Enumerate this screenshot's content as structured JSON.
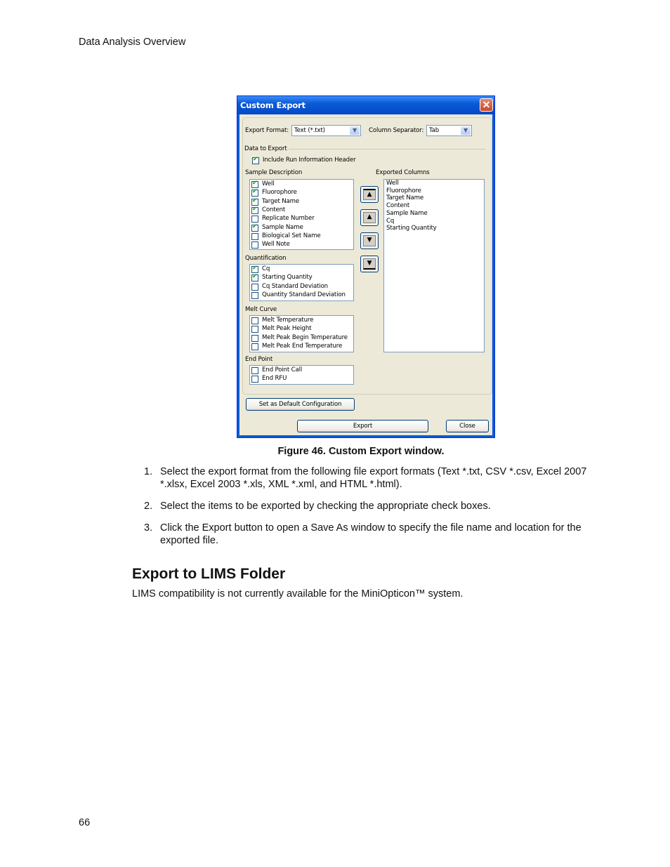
{
  "running_head": "Data Analysis Overview",
  "page_number": "66",
  "dialog": {
    "title": "Custom Export",
    "close_glyph": "✕",
    "export_format_label": "Export Format:",
    "export_format_value": "Text (*.txt)",
    "column_separator_label": "Column Separator:",
    "column_separator_value": "Tab",
    "data_to_export_label": "Data to Export",
    "include_header": {
      "label": "Include Run Information Header",
      "checked": true
    },
    "sample_description": {
      "label": "Sample Description",
      "items": [
        {
          "label": "Well",
          "checked": true
        },
        {
          "label": "Fluorophore",
          "checked": true
        },
        {
          "label": "Target Name",
          "checked": true
        },
        {
          "label": "Content",
          "checked": true
        },
        {
          "label": "Replicate Number",
          "checked": false
        },
        {
          "label": "Sample Name",
          "checked": true
        },
        {
          "label": "Biological Set Name",
          "checked": false
        },
        {
          "label": "Well Note",
          "checked": false
        }
      ]
    },
    "quantification": {
      "label": "Quantification",
      "items": [
        {
          "label": "Cq",
          "checked": true
        },
        {
          "label": "Starting Quantity",
          "checked": true
        },
        {
          "label": "Cq Standard Deviation",
          "checked": false
        },
        {
          "label": "Quantity Standard Deviation",
          "checked": false
        }
      ]
    },
    "melt_curve": {
      "label": "Melt Curve",
      "items": [
        {
          "label": "Melt Temperature",
          "checked": false
        },
        {
          "label": "Melt Peak Height",
          "checked": false
        },
        {
          "label": "Melt Peak Begin Temperature",
          "checked": false
        },
        {
          "label": "Melt Peak End Temperature",
          "checked": false
        }
      ]
    },
    "end_point": {
      "label": "End Point",
      "items": [
        {
          "label": "End Point Call",
          "checked": false
        },
        {
          "label": "End RFU",
          "checked": false
        }
      ]
    },
    "exported_columns_label": "Exported Columns",
    "exported_columns": [
      "Well",
      "Fluorophore",
      "Target Name",
      "Content",
      "Sample Name",
      "Cq",
      "Starting Quantity"
    ],
    "move_buttons": {
      "top": "▲",
      "up": "▲",
      "down": "▼",
      "bottom": "▼"
    },
    "set_default_label": "Set as Default Configuration",
    "export_label": "Export",
    "close_label": "Close"
  },
  "caption": "Figure 46. Custom Export window.",
  "steps": [
    {
      "n": "1.",
      "text": "Select the export format from the following file export formats (Text *.txt, CSV *.csv, Excel 2007 *.xlsx, Excel 2003 *.xls, XML *.xml, and HTML *.html)."
    },
    {
      "n": "2.",
      "text": "Select the items to be exported by checking the appropriate check boxes."
    },
    {
      "n": "3.",
      "text": "Click the Export button to open a Save As window to specify the file name and location for the exported file."
    }
  ],
  "section_heading": "Export to LIMS Folder",
  "section_text": "LIMS compatibility is not currently available for the MiniOpticon™ system."
}
